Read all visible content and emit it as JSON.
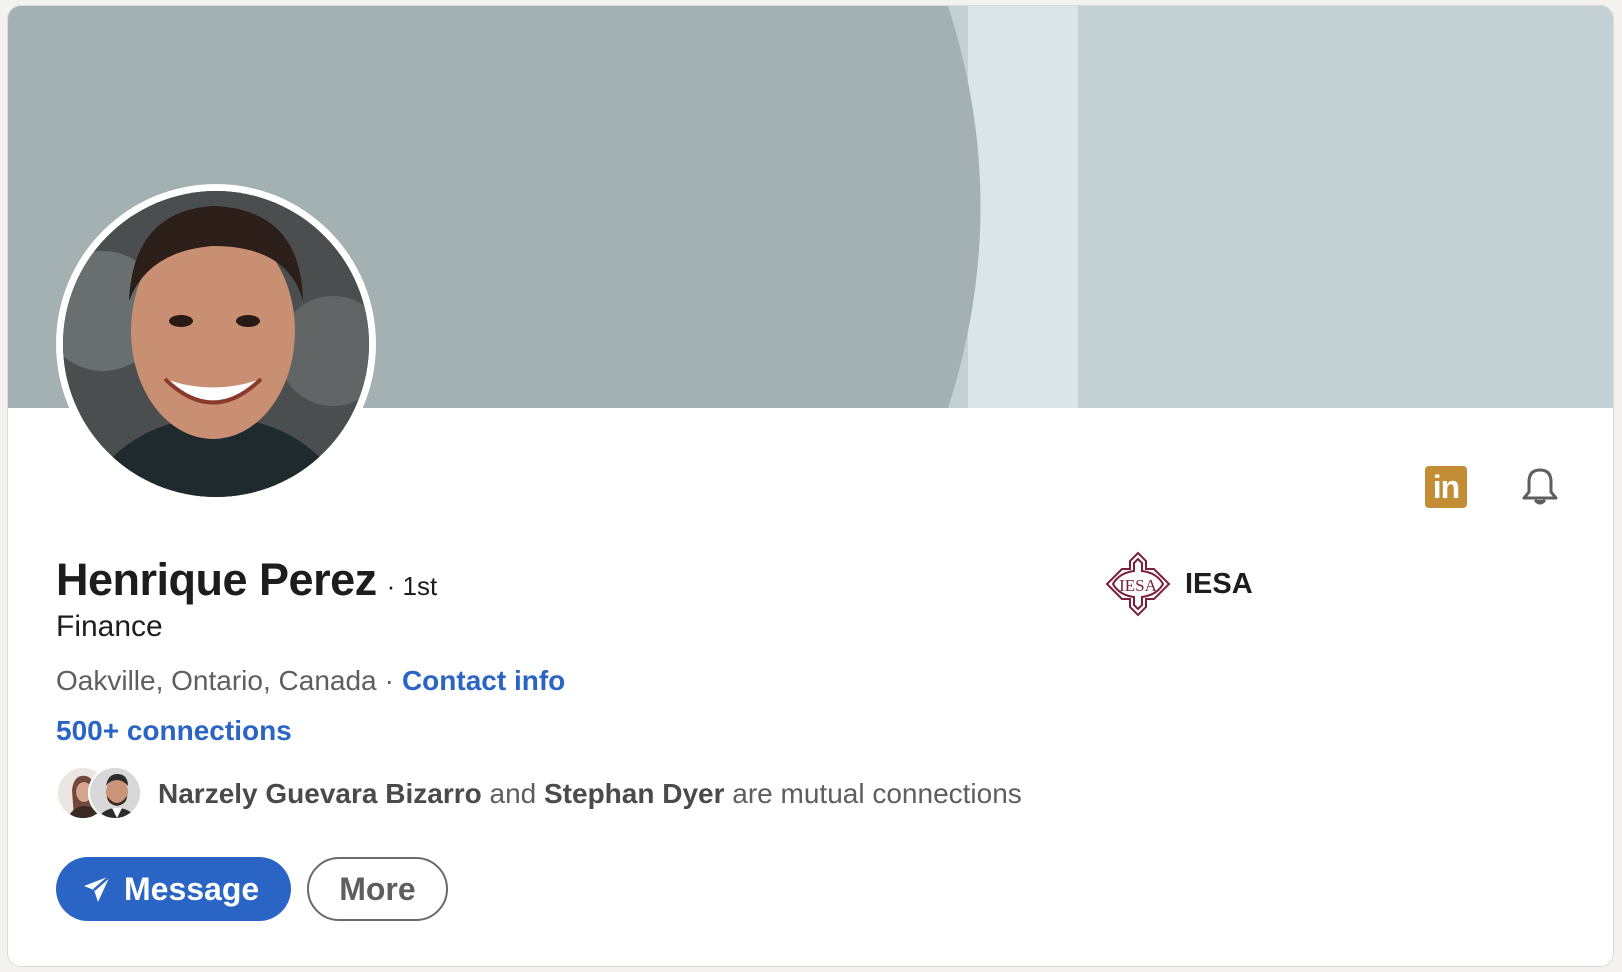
{
  "profile": {
    "name": "Henrique Perez",
    "degree": "· 1st",
    "headline": "Finance",
    "location": "Oakville, Ontario, Canada",
    "separator": "·",
    "contact_info": "Contact info",
    "connections": "500+ connections"
  },
  "mutual": {
    "person1": "Narzely Guevara Bizarro",
    "and": "and",
    "person2": "Stephan Dyer",
    "suffix": "are mutual connections"
  },
  "education": {
    "name": "IESA",
    "logo_text": "IESA"
  },
  "actions": {
    "message": "Message",
    "more": "More"
  },
  "icons": {
    "linkedin": "linkedin-icon",
    "bell": "bell-icon",
    "send": "send-icon",
    "linkedin_glyph": "in"
  },
  "colors": {
    "accent": "#2a64c5",
    "linkedin_badge": "#c38d35",
    "banner_dark": "#a3b1b3",
    "banner_light": "#c3d1d4",
    "iesa_logo": "#7a1f3a"
  }
}
